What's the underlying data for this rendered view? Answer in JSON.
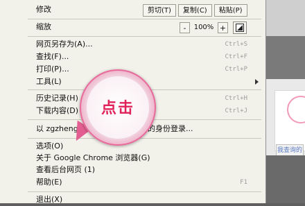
{
  "menu": {
    "edit": {
      "label": "修改",
      "cut": "剪切(T)",
      "copy": "复制(C)",
      "paste": "粘贴(P)"
    },
    "zoom": {
      "label": "缩放",
      "minus": "-",
      "value": "100%",
      "plus": "+"
    },
    "items": [
      {
        "label": "网页另存为(A)...",
        "shortcut": "Ctrl+S"
      },
      {
        "label": "查找(F)...",
        "shortcut": "Ctrl+F"
      },
      {
        "label": "打印(P)...",
        "shortcut": "Ctrl+P"
      },
      {
        "label": "工具(L)",
        "shortcut": ""
      },
      {
        "label": "历史记录(H)",
        "shortcut": "Ctrl+H"
      },
      {
        "label": "下载内容(D)",
        "shortcut": "Ctrl+J"
      },
      {
        "label": "以 zgzhenghao",
        "shortcut": ""
      },
      {
        "label_suffix": "的身份登录..."
      },
      {
        "label": "选项(O)",
        "shortcut": ""
      },
      {
        "label": "关于 Google Chrome 浏览器(G)",
        "shortcut": ""
      },
      {
        "label": "查看后台网页 (1)",
        "shortcut": ""
      },
      {
        "label": "帮助(E)",
        "shortcut": "F1"
      },
      {
        "label": "退出(X)",
        "shortcut": ""
      }
    ]
  },
  "callout": {
    "text": "点击"
  },
  "background": {
    "button_label": "我查询的"
  },
  "colors": {
    "menu_bg": "#f2f1ea",
    "accent_pink": "#e35f91",
    "callout_text": "#e0225a"
  }
}
